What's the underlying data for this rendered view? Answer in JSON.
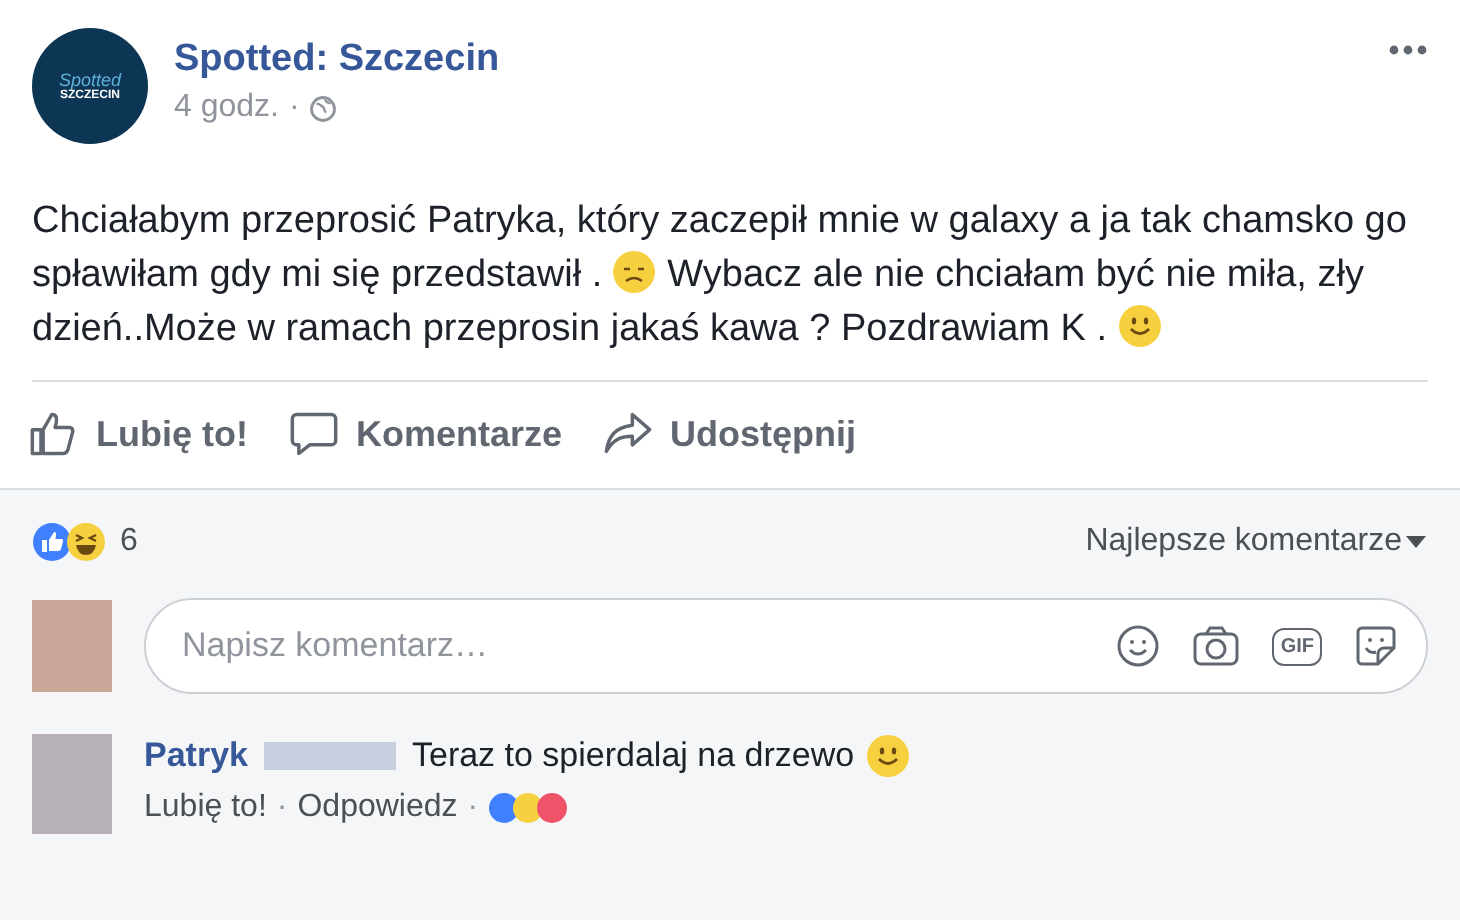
{
  "post": {
    "page_name": "Spotted: Szczecin",
    "logo_text": [
      "Spotted",
      "SZCZECIN"
    ],
    "time": "4 godz.",
    "separator": "·",
    "text": "Chciałabym przeprosić Patryka, który zaczepił mnie w galaxy a ja tak chamsko go spławiłam gdy mi się przedstawił .",
    "text_2": "Wybacz ale nie chciałam być nie miła, zły dzień..Może w ramach przeprosin jakaś kawa ? Pozdrawiam K ."
  },
  "actions": [
    {
      "kind": "like",
      "label": "Lubię to!"
    },
    {
      "kind": "comment",
      "label": "Komentarze"
    },
    {
      "kind": "share",
      "label": "Udostępnij"
    }
  ],
  "reactions": {
    "count": "6",
    "sort": "Najlepsze komentarze"
  },
  "composer": {
    "placeholder": "Napisz komentarz…",
    "gif_label": "GIF"
  },
  "comments": [
    {
      "author": "Patryk",
      "text": "Teraz to spierdalaj na drzewo",
      "actions": [
        "Lubię to!",
        "Odpowiedz"
      ],
      "separator": "·"
    }
  ]
}
